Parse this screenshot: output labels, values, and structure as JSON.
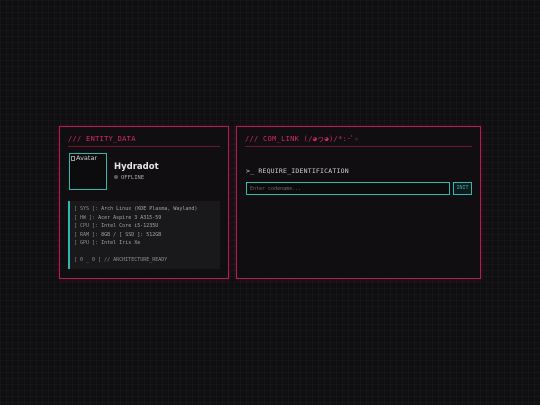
{
  "entity_panel": {
    "header": "/// ENTITY_DATA",
    "avatar_alt": "Avatar",
    "name": "Hydradot",
    "status": "OFFLINE",
    "specs": [
      {
        "key": "[ SYS ]:",
        "value": "Arch Linux (KDE Plasma, Wayland)"
      },
      {
        "key": "[ HW ]:",
        "value": "Acer Aspire 3 A315-59"
      },
      {
        "key": "[ CPU ]:",
        "value": "Intel Core i5-1235U"
      },
      {
        "key": "[ RAM ]:",
        "value": "8GB / [ SSD ]: 512GB"
      },
      {
        "key": "[ GPU ]:",
        "value": "Intel Iris Xe"
      }
    ],
    "footer": "[ 0 _ 0 ] // ARCHITECTURE_READY"
  },
  "comlink_panel": {
    "header": "/// COM_LINK (/◕ヮ◕)/*:･ﾟ✧",
    "prompt": ">_ REQUIRE_IDENTIFICATION",
    "input_placeholder": "Enter codename...",
    "input_value": "",
    "init_label": "INIT"
  },
  "colors": {
    "accent_pink": "#d62a62",
    "accent_cyan": "#2fb8b0",
    "background": "#0f0e10"
  }
}
